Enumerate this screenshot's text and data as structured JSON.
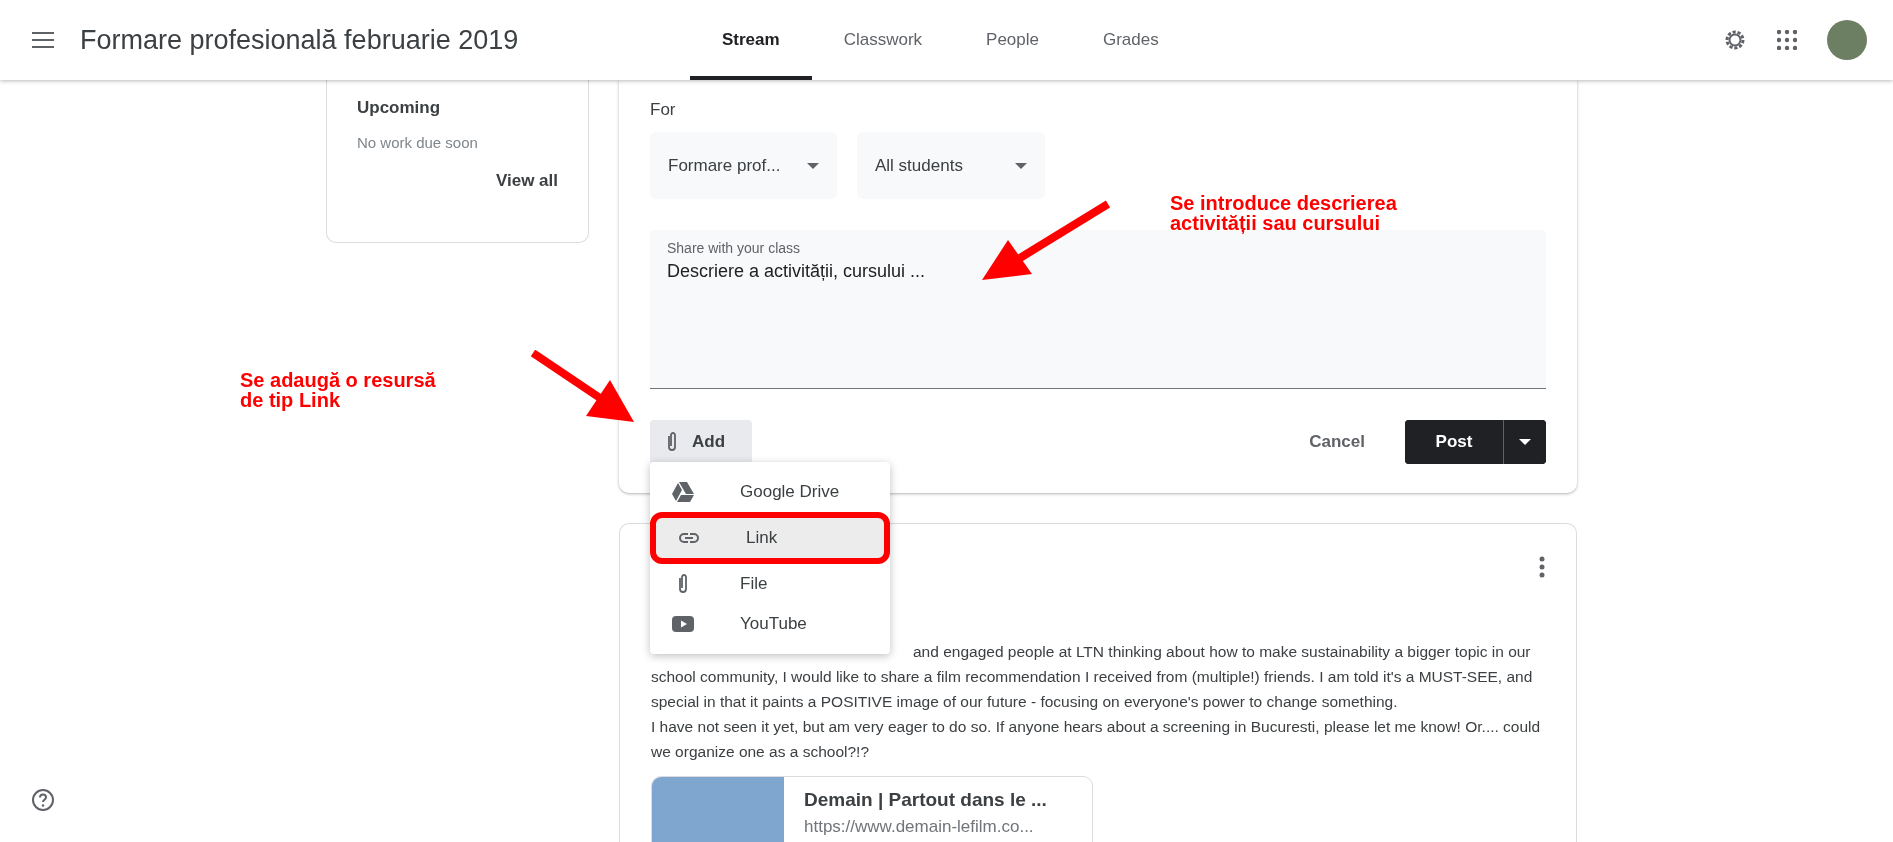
{
  "header": {
    "title": "Formare profesională februarie 2019",
    "tabs": [
      {
        "label": "Stream",
        "selected": true
      },
      {
        "label": "Classwork",
        "selected": false
      },
      {
        "label": "People",
        "selected": false
      },
      {
        "label": "Grades",
        "selected": false
      }
    ]
  },
  "upcoming": {
    "title": "Upcoming",
    "message": "No work due soon",
    "link": "View all"
  },
  "composer": {
    "for_label": "For",
    "class_dropdown": "Formare prof...",
    "students_dropdown": "All students",
    "field": {
      "label": "Share with your class",
      "value": "Descriere a activității, cursului ..."
    },
    "add_button": "Add",
    "cancel_button": "Cancel",
    "post_button": "Post"
  },
  "add_menu": {
    "items": [
      {
        "kind": "drive",
        "label": "Google Drive",
        "selected": false
      },
      {
        "kind": "link",
        "label": "Link",
        "selected": true
      },
      {
        "kind": "file",
        "label": "File",
        "selected": false
      },
      {
        "kind": "youtube",
        "label": "YouTube",
        "selected": false
      }
    ]
  },
  "post": {
    "paragraphs": [
      "and engaged people at LTN thinking about how to make sustainability a bigger topic in our school community, I would like to share a film recommendation I received from (multiple!) friends. I am told it's a MUST-SEE, and special in that it paints a POSITIVE image of our future - focusing on everyone's power to change something.",
      "I have not seen it yet, but am very eager to do so. If anyone hears about a screening in Bucuresti, please let me know! Or.... could we organize one as a school?!?"
    ],
    "link_preview": {
      "title": "Demain | Partout dans le ...",
      "url": "https://www.demain-lefilm.co..."
    }
  },
  "annotations": [
    {
      "kind": "description",
      "lines": [
        "Se introduce descrierea",
        "activității sau cursului"
      ]
    },
    {
      "kind": "add",
      "lines": [
        "Se adaugă o resursă",
        "de tip Link"
      ]
    }
  ]
}
